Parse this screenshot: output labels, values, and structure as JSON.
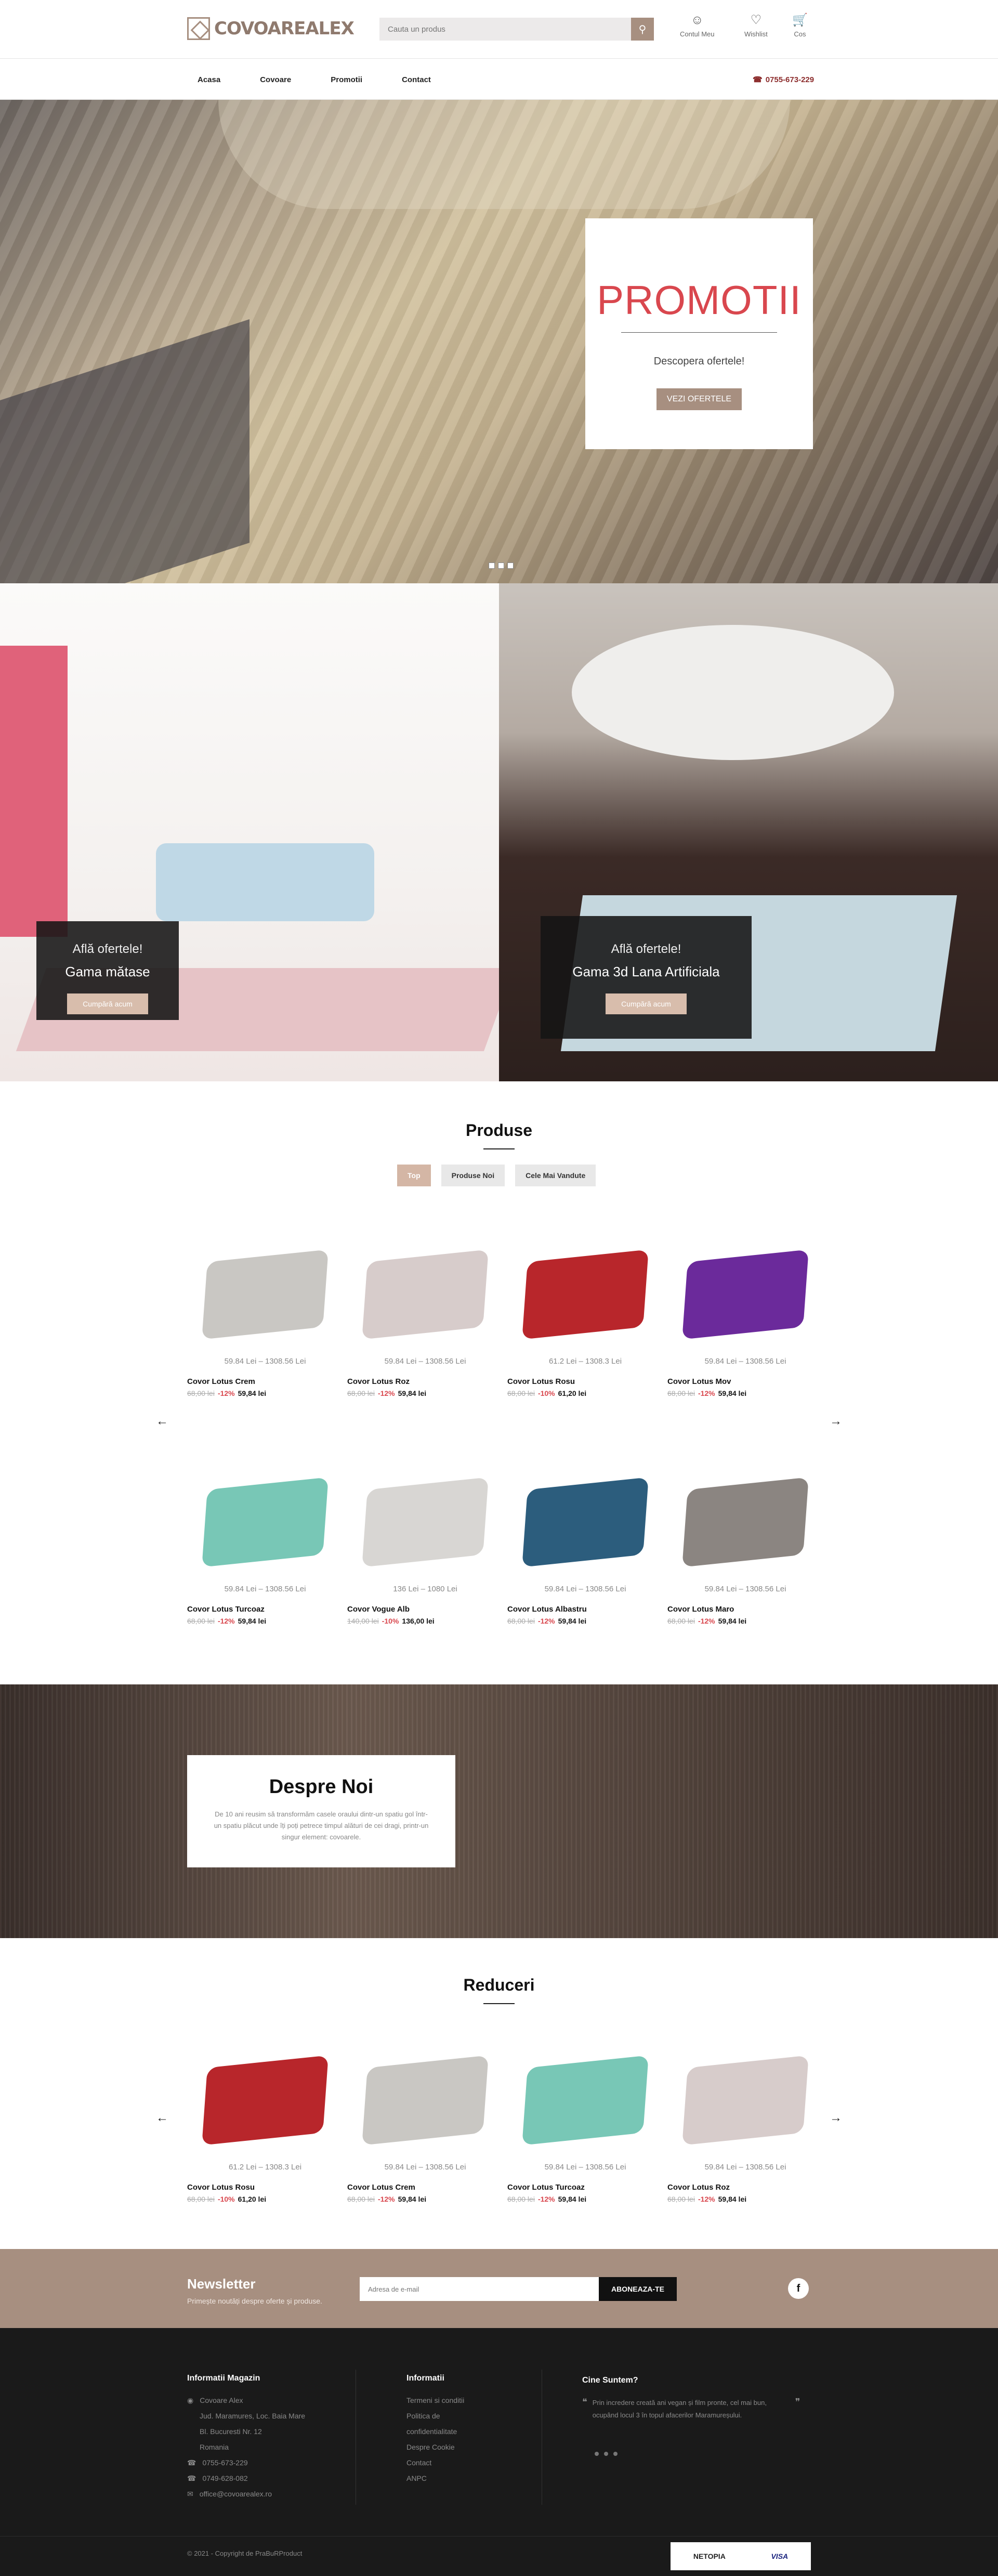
{
  "header": {
    "logo_text": "COVOAREALEX",
    "search_placeholder": "Cauta un produs",
    "account_label": "Contul Meu",
    "wishlist_label": "Wishlist",
    "cart_label": "Cos"
  },
  "nav": {
    "items": [
      "Acasa",
      "Covoare",
      "Promotii",
      "Contact"
    ],
    "phone": "0755-673-229"
  },
  "hero": {
    "title": "PROMOTII",
    "subtitle": "Descopera ofertele!",
    "button": "VEZI OFERTELE"
  },
  "banners": [
    {
      "small": "Află ofertele!",
      "big": "Gama mătase",
      "button": "Cumpără acum"
    },
    {
      "small": "Află ofertele!",
      "big": "Gama 3d Lana Artificiala",
      "button": "Cumpără acum"
    }
  ],
  "products_section": {
    "title": "Produse",
    "tabs": [
      "Top",
      "Produse Noi",
      "Cele Mai Vandute"
    ],
    "active_tab": "Top",
    "items": [
      {
        "range": "59.84 Lei – 1308.56 Lei",
        "name": "Covor Lotus Crem",
        "old": "68,00 lei",
        "disc": "-12%",
        "new": "59,84 lei",
        "color": "#c9c7c3"
      },
      {
        "range": "59.84 Lei – 1308.56 Lei",
        "name": "Covor Lotus Roz",
        "old": "68,00 lei",
        "disc": "-12%",
        "new": "59,84 lei",
        "color": "#d7cccb"
      },
      {
        "range": "61.2 Lei – 1308.3 Lei",
        "name": "Covor Lotus Rosu",
        "old": "68,00 lei",
        "disc": "-10%",
        "new": "61,20 lei",
        "color": "#b8262b"
      },
      {
        "range": "59.84 Lei – 1308.56 Lei",
        "name": "Covor Lotus Mov",
        "old": "68,00 lei",
        "disc": "-12%",
        "new": "59,84 lei",
        "color": "#6b2a9b"
      },
      {
        "range": "59.84 Lei – 1308.56 Lei",
        "name": "Covor Lotus Turcoaz",
        "old": "68,00 lei",
        "disc": "-12%",
        "new": "59,84 lei",
        "color": "#78c7b6"
      },
      {
        "range": "136 Lei – 1080 Lei",
        "name": "Covor Vogue Alb",
        "old": "140,00 lei",
        "disc": "-10%",
        "new": "136,00 lei",
        "color": "#d8d6d3"
      },
      {
        "range": "59.84 Lei – 1308.56 Lei",
        "name": "Covor Lotus Albastru",
        "old": "68,00 lei",
        "disc": "-12%",
        "new": "59,84 lei",
        "color": "#2c5d7d"
      },
      {
        "range": "59.84 Lei – 1308.56 Lei",
        "name": "Covor Lotus Maro",
        "old": "68,00 lei",
        "disc": "-12%",
        "new": "59,84 lei",
        "color": "#8b8581"
      }
    ]
  },
  "about": {
    "title": "Despre Noi",
    "text": "De 10 ani reusim să transformăm casele oraului dintr-un spatiu gol într-un spatiu plăcut unde îți poți petrece timpul alături de cei dragi, printr-un singur element: covoarele."
  },
  "discounts": {
    "title": "Reduceri",
    "items": [
      {
        "range": "61.2 Lei – 1308.3 Lei",
        "name": "Covor Lotus Rosu",
        "old": "68,00 lei",
        "disc": "-10%",
        "new": "61,20 lei",
        "color": "#b8262b"
      },
      {
        "range": "59.84 Lei – 1308.56 Lei",
        "name": "Covor Lotus Crem",
        "old": "68,00 lei",
        "disc": "-12%",
        "new": "59,84 lei",
        "color": "#c9c7c3"
      },
      {
        "range": "59.84 Lei – 1308.56 Lei",
        "name": "Covor Lotus Turcoaz",
        "old": "68,00 lei",
        "disc": "-12%",
        "new": "59,84 lei",
        "color": "#78c7b6"
      },
      {
        "range": "59.84 Lei – 1308.56 Lei",
        "name": "Covor Lotus Roz",
        "old": "68,00 lei",
        "disc": "-12%",
        "new": "59,84 lei",
        "color": "#d7cccb"
      }
    ]
  },
  "newsletter": {
    "title": "Newsletter",
    "subtitle": "Primește noutăți despre oferte și produse.",
    "placeholder": "Adresa de e-mail",
    "button": "ABONEAZA-TE"
  },
  "footer": {
    "col1_title": "Informatii Magazin",
    "address": [
      "Covoare Alex",
      "Jud. Maramures, Loc. Baia Mare",
      "Bl. Bucuresti Nr. 12",
      "Romania"
    ],
    "phone1": "0755-673-229",
    "phone2": "0749-628-082",
    "email": "office@covoarealex.ro",
    "col2_title": "Informatii",
    "links": [
      "Termeni si conditii",
      "Politica de",
      "confidentialitate",
      "Despre Cookie",
      "Contact",
      "ANPC"
    ],
    "col3_title": "Cine Suntem?",
    "quote": "Prin incredere creată ani vegan și film pronte, cel mai bun, ocupând locul 3 în topul afacerilor Maramureșului.",
    "copyright": "© 2021 - Copyright de PraBuRProduct",
    "pay_1": "NETOPIA",
    "pay_2": "VISA"
  }
}
